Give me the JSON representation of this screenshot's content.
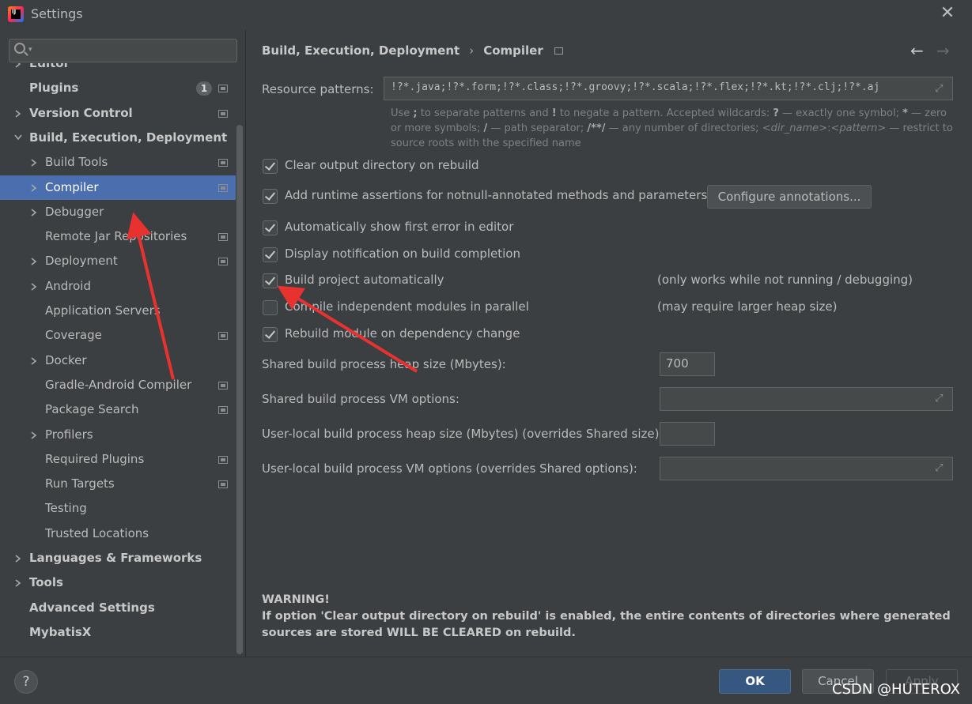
{
  "window": {
    "title": "Settings",
    "close": "✕"
  },
  "search": {
    "placeholder": ""
  },
  "sidebar": {
    "items": [
      {
        "label": "Editor",
        "bold": true,
        "chevron": "right"
      },
      {
        "label": "Plugins",
        "bold": true,
        "badge": "1"
      },
      {
        "label": "Version Control",
        "bold": true,
        "chevron": "right"
      },
      {
        "label": "Build, Execution, Deployment",
        "bold": true,
        "chevron": "down"
      },
      {
        "label": "Build Tools",
        "chevron": "right"
      },
      {
        "label": "Compiler",
        "chevron": "right",
        "selected": true
      },
      {
        "label": "Debugger",
        "chevron": "right"
      },
      {
        "label": "Remote Jar Repositories"
      },
      {
        "label": "Deployment",
        "chevron": "right"
      },
      {
        "label": "Android",
        "chevron": "right"
      },
      {
        "label": "Application Servers"
      },
      {
        "label": "Coverage"
      },
      {
        "label": "Docker",
        "chevron": "right"
      },
      {
        "label": "Gradle-Android Compiler"
      },
      {
        "label": "Package Search"
      },
      {
        "label": "Profilers",
        "chevron": "right"
      },
      {
        "label": "Required Plugins"
      },
      {
        "label": "Run Targets"
      },
      {
        "label": "Testing"
      },
      {
        "label": "Trusted Locations"
      },
      {
        "label": "Languages & Frameworks",
        "bold": true,
        "chevron": "right"
      },
      {
        "label": "Tools",
        "bold": true,
        "chevron": "right"
      },
      {
        "label": "Advanced Settings",
        "bold": true
      },
      {
        "label": "MybatisX",
        "bold": true
      }
    ]
  },
  "breadcrumb": {
    "parent": "Build, Execution, Deployment",
    "sep": "›",
    "current": "Compiler"
  },
  "nav": {
    "back": "←",
    "forward": "→"
  },
  "resource": {
    "label": "Resource patterns:",
    "value": "!?*.java;!?*.form;!?*.class;!?*.groovy;!?*.scala;!?*.flex;!?*.kt;!?*.clj;!?*.aj",
    "hint": {
      "p1": "Use ",
      "k1": ";",
      "p2": " to separate patterns and ",
      "k2": "!",
      "p3": " to negate a pattern. Accepted wildcards: ",
      "k3": "?",
      "p4": " — exactly one symbol; ",
      "k4": "*",
      "p5": " — zero or more symbols; ",
      "k5": "/",
      "p6": " — path separator; ",
      "k6": "/**/",
      "p7": " — any number of directories; ",
      "i1": "<dir_name>",
      "p8": ":",
      "i2": "<pattern>",
      "p9": " — restrict to source roots with the specified name"
    }
  },
  "options": [
    {
      "label": "Clear output directory on rebuild",
      "checked": true
    },
    {
      "label": "Add runtime assertions for notnull-annotated methods and parameters",
      "checked": true,
      "button": "Configure annotations..."
    },
    {
      "label": "Automatically show first error in editor",
      "checked": true
    },
    {
      "label": "Display notification on build completion",
      "checked": true
    },
    {
      "label": "Build project automatically",
      "checked": true,
      "note": "(only works while not running / debugging)"
    },
    {
      "label": "Compile independent modules in parallel",
      "checked": false,
      "note": "(may require larger heap size)"
    },
    {
      "label": "Rebuild module on dependency change",
      "checked": true
    }
  ],
  "fields": {
    "heap_label": "Shared build process heap size (Mbytes):",
    "heap_value": "700",
    "vm_label": "Shared build process VM options:",
    "user_heap_label": "User-local build process heap size (Mbytes) (overrides Shared size):",
    "user_vm_label": "User-local build process VM options (overrides Shared options):"
  },
  "warning": {
    "title": "WARNING!",
    "body": "If option 'Clear output directory on rebuild' is enabled, the entire contents of directories where generated sources are stored WILL BE CLEARED on rebuild."
  },
  "footer": {
    "help": "?",
    "ok": "OK",
    "cancel": "Cancel",
    "apply": "Apply",
    "watermark": "CSDN @HUTEROX"
  },
  "colors": {
    "selection": "#4b6eaf",
    "annotation_arrow": "#e8322f",
    "ok_button": "#365880"
  }
}
